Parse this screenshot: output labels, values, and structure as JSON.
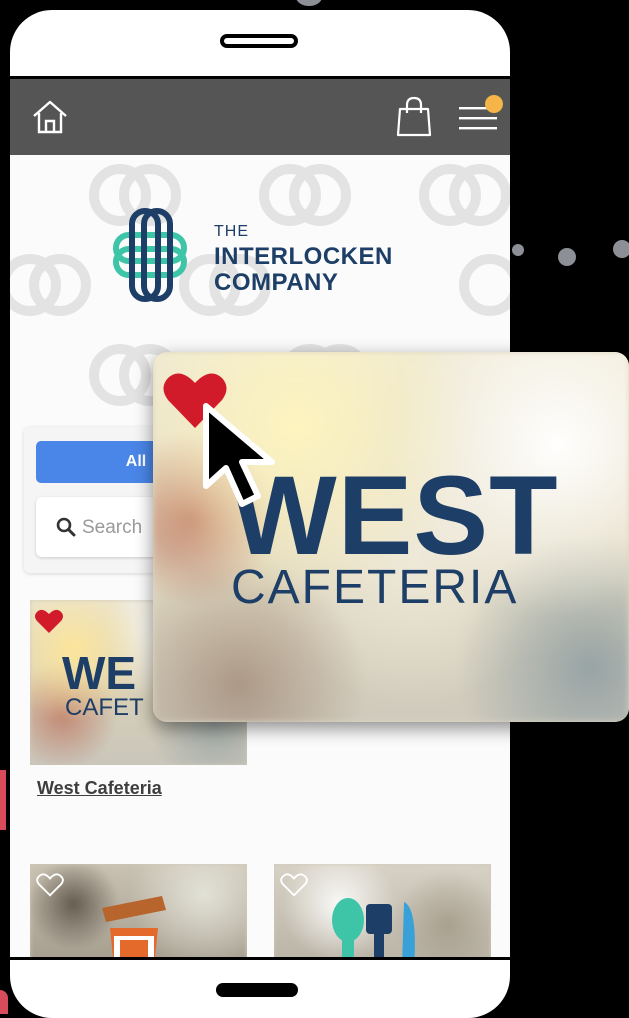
{
  "brand": {
    "line1": "THE",
    "line2": "INTERLOCKEN",
    "line3": "COMPANY",
    "primary_color": "#1d3e66",
    "accent_color": "#3ec5a8"
  },
  "appbar": {
    "home_icon": "home-icon",
    "bag_icon": "shopping-bag-icon",
    "menu_icon": "hamburger-menu-icon",
    "notification_dot_color": "#f5b547",
    "background": "#555555"
  },
  "filter": {
    "all_label": "All",
    "search_placeholder": "Search"
  },
  "listings": [
    {
      "title": "West Cafeteria",
      "image_word1": "WEST",
      "image_word2": "CAFETERIA",
      "favorited": true
    },
    {
      "title": "",
      "favorited": false
    },
    {
      "title": "",
      "favorited": false
    }
  ],
  "popout": {
    "word1": "WEST",
    "word2": "CAFETERIA",
    "heart_color": "#d11a2a"
  },
  "thumb_west_crop": {
    "word1": "WE",
    "word2": "CAFET"
  }
}
